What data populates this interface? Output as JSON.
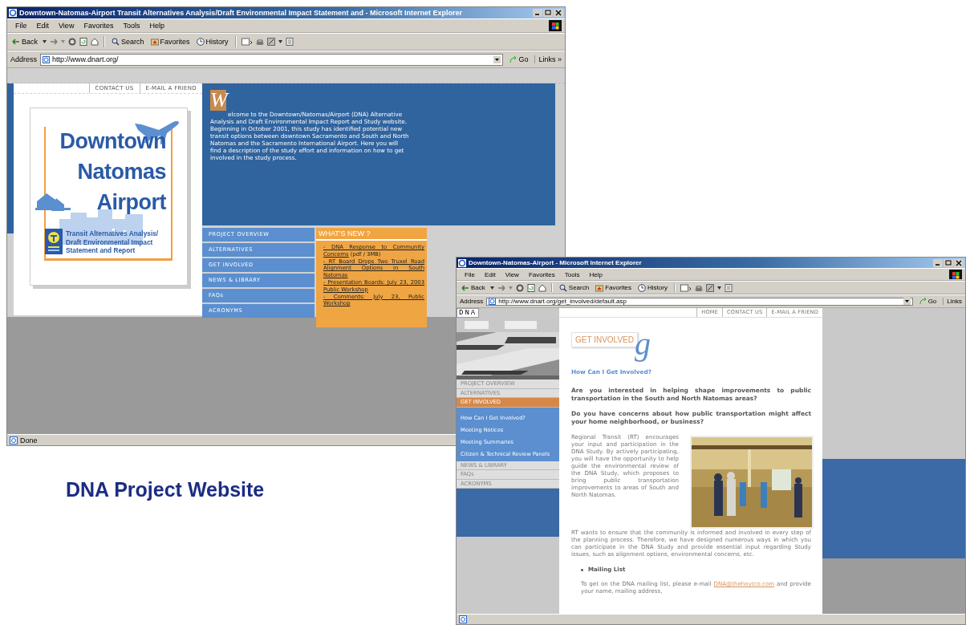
{
  "windows": [
    {
      "title": "Downtown-Natomas-Airport Transit Alternatives Analysis/Draft Environmental Impact Statement and - Microsoft Internet Explorer",
      "menu": [
        "File",
        "Edit",
        "View",
        "Favorites",
        "Tools",
        "Help"
      ],
      "toolbar": [
        "Back",
        "Search",
        "Favorites",
        "History"
      ],
      "address_label": "Address",
      "url": "http://www.dnart.org/",
      "go": "Go",
      "links": "Links »",
      "status": "Done",
      "page": {
        "kind": "home",
        "top_links": [
          "CONTACT US",
          "E-MAIL A FRIEND"
        ],
        "logo": {
          "lines": [
            "Downtown",
            "Natomas",
            "Airport"
          ],
          "subtitle": "Transit Alternatives Analysis/ Draft Environmental Impact Statement and Report"
        },
        "welcome": {
          "initial": "W",
          "text": "elcome to the Downtown/Natomas/Airport (DNA) Alternative Analysis and Draft Environmental Impact Report and Study website. Beginning in October 2001, this study has identified potential new transit options between downtown Sacramento and South and North Natomas and the Sacramento International Airport. Here you will find a description of the study effort and information on how to get involved in the study process."
        },
        "nav": [
          "PROJECT OVERVIEW",
          "ALTERNATIVES",
          "GET INVOLVED",
          "NEWS & LIBRARY",
          "FAQs",
          "ACRONYMS"
        ],
        "whats_new": {
          "title": "WHAT'S NEW ?",
          "items": [
            {
              "link": "- DNA Response to Community Concerns",
              "note": "(pdf / 3MB)"
            },
            {
              "link": "- RT Board Drops Two Truxel Road Alignment Options in South Natomas"
            },
            {
              "link": "- Presentation Boards: July 23, 2003 Public Workshop"
            },
            {
              "link": "- Comments: July 23, Public Workshop"
            }
          ]
        }
      }
    },
    {
      "title": "Downtown-Natomas-Airport - Microsoft Internet Explorer",
      "menu": [
        "File",
        "Edit",
        "View",
        "Favorites",
        "Tools",
        "Help"
      ],
      "toolbar": [
        "Back",
        "Search",
        "Favorites",
        "History"
      ],
      "address_label": "Address",
      "url": "http://www.dnart.org/get_involved/default.asp",
      "go": "Go",
      "links": "Links",
      "page": {
        "kind": "section",
        "brand": "DNA",
        "top_links": [
          "HOME",
          "CONTACT US",
          "E-MAIL A FRIEND"
        ],
        "nav": [
          {
            "kind": "main",
            "label": "PROJECT OVERVIEW",
            "selected": false
          },
          {
            "kind": "main",
            "label": "ALTERNATIVES",
            "selected": false
          },
          {
            "kind": "main",
            "label": "GET INVOLVED",
            "selected": true
          },
          {
            "kind": "sub",
            "label": "How Can I Get Involved?",
            "selected": false
          },
          {
            "kind": "sub",
            "label": "Meeting Notices",
            "selected": false
          },
          {
            "kind": "sub",
            "label": "Meeting Summaries",
            "selected": false
          },
          {
            "kind": "sub",
            "label": "Citizen & Technical Review Panels",
            "selected": false
          },
          {
            "kind": "main",
            "label": "NEWS & LIBRARY",
            "selected": false
          },
          {
            "kind": "main",
            "label": "FAQs",
            "selected": false
          },
          {
            "kind": "main",
            "label": "ACRONYMS",
            "selected": false
          }
        ],
        "heading": "GET INVOLVED",
        "heading_mark": "g",
        "subheading": "How Can I Get Involved?",
        "questions": [
          "Are you interested in helping shape improvements to public transportation in the South and North Natomas areas?",
          "Do you have concerns about how public transportation might affect your home neighborhood, or business?"
        ],
        "paragraphs": [
          "Regional Transit (RT) encourages your input and participation in the DNA Study. By actively participating, you will have the opportunity to help guide the environmental review of the DNA Study, which proposes to bring public transportation improvements to areas of South and North Natomas.",
          "RT wants to ensure that the community is informed and involved in every step of the planning process. Therefore, we have designed numerous ways in which you can participate in the DNA Study and provide essential input regarding Study issues, such as alignment options, environmental concerns, etc."
        ],
        "bullet": "Mailing List",
        "mailing": {
          "before": "To get on the DNA mailing list, please e-mail",
          "link": "DNA@thehoytco.com",
          "after": "and provide your name, mailing address,"
        }
      }
    }
  ],
  "caption": "DNA Project Website"
}
